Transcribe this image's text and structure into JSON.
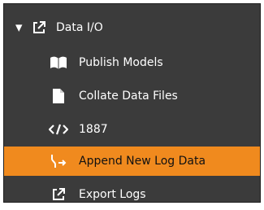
{
  "tree": {
    "header": {
      "label": "Data I/O",
      "icon": "external-link-icon",
      "expanded": true
    },
    "items": [
      {
        "label": "Publish Models",
        "icon": "book-icon"
      },
      {
        "label": "Collate Data Files",
        "icon": "document-icon"
      },
      {
        "label": "1887",
        "icon": "code-icon"
      },
      {
        "label": "Append New Log Data",
        "icon": "append-icon",
        "selected": true
      },
      {
        "label": "Export Logs",
        "icon": "external-link-icon"
      }
    ]
  },
  "colors": {
    "background": "#3b3b3b",
    "selected": "#f08a1e",
    "text": "#ffffff"
  }
}
